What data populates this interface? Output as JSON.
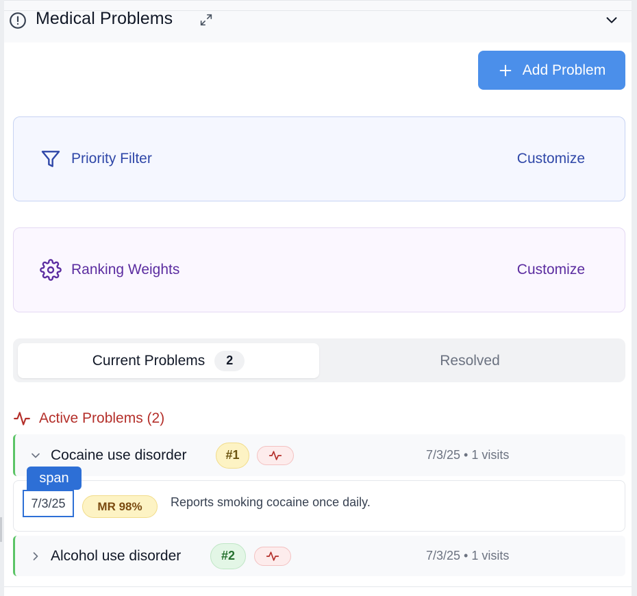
{
  "header": {
    "title": "Medical Problems",
    "icons": {
      "alert": "alert-circle-icon",
      "expand": "expand-icon",
      "collapse": "chevron-down-icon"
    }
  },
  "add_button": {
    "label": "Add Problem",
    "icon": "plus-icon",
    "color": "#4b8fea"
  },
  "priority_filter": {
    "label": "Priority Filter",
    "action": "Customize",
    "icon": "filter-icon",
    "color": "#2f47a8"
  },
  "ranking_weights": {
    "label": "Ranking Weights",
    "action": "Customize",
    "icon": "gear-icon",
    "color": "#5b2ca0"
  },
  "tabs": {
    "current": {
      "label": "Current Problems",
      "count": "2"
    },
    "resolved": {
      "label": "Resolved"
    }
  },
  "active_section": {
    "title": "Active Problems (2)",
    "icon": "activity-icon",
    "color": "#b42f2a"
  },
  "problems": [
    {
      "name": "Cocaine use disorder",
      "rank": "#1",
      "meta": "7/3/25 • 1 visits",
      "expanded": true,
      "detail": {
        "date": "7/3/25",
        "badge": "MR 98%",
        "text": "Reports smoking cocaine once daily."
      }
    },
    {
      "name": "Alcohol use disorder",
      "rank": "#2",
      "meta": "7/3/25 • 1 visits",
      "expanded": false
    }
  ],
  "inspector": {
    "tag": "span"
  }
}
